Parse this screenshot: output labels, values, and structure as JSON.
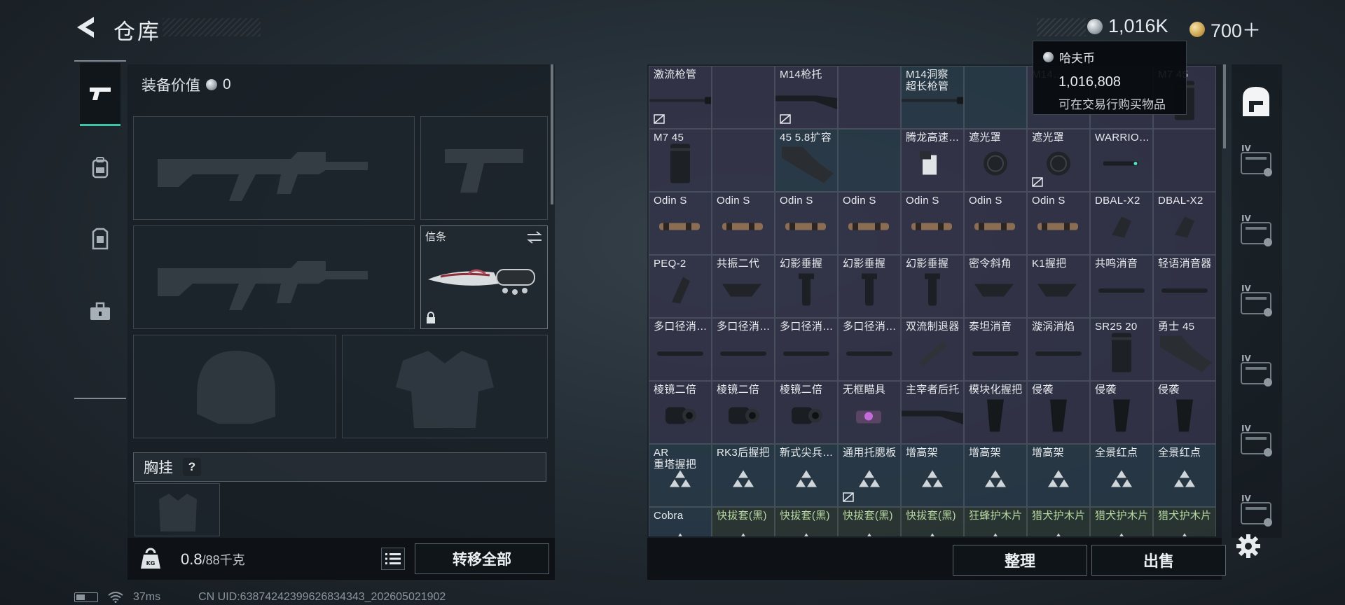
{
  "header": {
    "title": "仓库",
    "currency": [
      {
        "icon": "silver-coin-icon",
        "value": "1,016K"
      },
      {
        "icon": "gold-coin-icon",
        "value": "700＋"
      }
    ]
  },
  "tooltip": {
    "name": "哈夫币",
    "value": "1,016,808",
    "desc": "可在交易行购买物品"
  },
  "equipment": {
    "value_label": "装备价值",
    "value": "0",
    "melee_slot_label": "信条",
    "chest_label": "胸挂",
    "chest_help": "?",
    "weight_current": "0.8",
    "weight_max": "/88千克",
    "transfer_all": "转移全部"
  },
  "left_nav": [
    "weapon-tab-icon",
    "backpack-tab-icon",
    "armor-tab-icon",
    "toolbox-tab-icon"
  ],
  "inventory": {
    "rows": [
      [
        {
          "name": "激流枪管",
          "c": "purple",
          "icon": "barrel",
          "mark": true
        },
        {
          "name": "",
          "c": "purple"
        },
        {
          "name": "M14枪托",
          "c": "purple",
          "icon": "stock",
          "mark": true
        },
        {
          "name": "",
          "c": "purple"
        },
        {
          "name": "M14洞察\n超长枪管",
          "c": "blue",
          "icon": "barrel"
        },
        {
          "name": "",
          "c": "blue"
        },
        {
          "name": "M14…",
          "c": "purple"
        },
        {
          "name": "",
          "c": "purple"
        },
        {
          "name": "M7 45",
          "c": "purple",
          "icon": "mag"
        }
      ],
      [
        {
          "name": "M7 45",
          "c": "purple",
          "icon": "mag"
        },
        {
          "name": "",
          "c": "purple"
        },
        {
          "name": "45 5.8扩容",
          "c": "blue",
          "icon": "curvemag"
        },
        {
          "name": "",
          "c": "blue"
        },
        {
          "name": "腾龙高速…",
          "c": "purple",
          "icon": "clip"
        },
        {
          "name": "遮光罩",
          "c": "purple",
          "icon": "hood"
        },
        {
          "name": "遮光罩",
          "c": "purple",
          "icon": "hood",
          "mark": true
        },
        {
          "name": "WARRIO…",
          "c": "purple",
          "icon": "laser"
        },
        {
          "name": "",
          "c": "purple"
        }
      ],
      [
        {
          "name": "Odin S",
          "c": "purple",
          "icon": "flashlight"
        },
        {
          "name": "Odin S",
          "c": "purple",
          "icon": "flashlight"
        },
        {
          "name": "Odin S",
          "c": "purple",
          "icon": "flashlight"
        },
        {
          "name": "Odin S",
          "c": "purple",
          "icon": "flashlight"
        },
        {
          "name": "Odin S",
          "c": "purple",
          "icon": "flashlight"
        },
        {
          "name": "Odin S",
          "c": "purple",
          "icon": "flashlight"
        },
        {
          "name": "Odin S",
          "c": "purple",
          "icon": "flashlight"
        },
        {
          "name": "DBAL-X2",
          "c": "purple",
          "icon": "dbal"
        },
        {
          "name": "DBAL-X2",
          "c": "purple",
          "icon": "dbal"
        }
      ],
      [
        {
          "name": "PEQ-2",
          "c": "purple",
          "icon": "peq"
        },
        {
          "name": "共振二代",
          "c": "purple",
          "icon": "angled"
        },
        {
          "name": "幻影垂握",
          "c": "purple",
          "icon": "vgrip"
        },
        {
          "name": "幻影垂握",
          "c": "purple",
          "icon": "vgrip"
        },
        {
          "name": "幻影垂握",
          "c": "purple",
          "icon": "vgrip"
        },
        {
          "name": "密令斜角",
          "c": "purple",
          "icon": "angled"
        },
        {
          "name": "K1握把",
          "c": "purple",
          "icon": "angled"
        },
        {
          "name": "共鸣消音",
          "c": "purple",
          "icon": "suppressor"
        },
        {
          "name": "轻语消音器",
          "c": "purple",
          "icon": "suppressor"
        }
      ],
      [
        {
          "name": "多口径消…",
          "c": "purple",
          "icon": "suppressor"
        },
        {
          "name": "多口径消…",
          "c": "purple",
          "icon": "suppressor"
        },
        {
          "name": "多口径消…",
          "c": "purple",
          "icon": "suppressor"
        },
        {
          "name": "多口径消…",
          "c": "purple",
          "icon": "suppressor"
        },
        {
          "name": "双流制退器",
          "c": "purple",
          "icon": "brake"
        },
        {
          "name": "泰坦消音",
          "c": "purple",
          "icon": "suppressor"
        },
        {
          "name": "漩涡消焰",
          "c": "purple",
          "icon": "suppressor"
        },
        {
          "name": "SR25 20",
          "c": "purple",
          "icon": "mag"
        },
        {
          "name": "勇士 45",
          "c": "purple",
          "icon": "curvemag"
        }
      ],
      [
        {
          "name": "棱镜二倍",
          "c": "purple",
          "icon": "scope"
        },
        {
          "name": "棱镜二倍",
          "c": "purple",
          "icon": "scope"
        },
        {
          "name": "棱镜二倍",
          "c": "purple",
          "icon": "scope"
        },
        {
          "name": "无框瞄具",
          "c": "purple",
          "icon": "holo"
        },
        {
          "name": "主宰者后托",
          "c": "purple",
          "icon": "stock"
        },
        {
          "name": "模块化握把",
          "c": "purple",
          "icon": "pgrip"
        },
        {
          "name": "侵袭",
          "c": "purple",
          "icon": "pgrip"
        },
        {
          "name": "侵袭",
          "c": "purple",
          "icon": "pgrip"
        },
        {
          "name": "侵袭",
          "c": "purple",
          "icon": "pgrip"
        }
      ],
      [
        {
          "name": "AR\n重塔握把",
          "c": "blue",
          "icon": "pyramid"
        },
        {
          "name": "RK3后握把",
          "c": "blue",
          "icon": "pyramid"
        },
        {
          "name": "新式尖兵…",
          "c": "blue",
          "icon": "pyramid"
        },
        {
          "name": "通用托腮板",
          "c": "blue",
          "icon": "pyramid",
          "mark": true
        },
        {
          "name": "增高架",
          "c": "blue",
          "icon": "pyramid"
        },
        {
          "name": "增高架",
          "c": "blue",
          "icon": "pyramid"
        },
        {
          "name": "增高架",
          "c": "blue",
          "icon": "pyramid"
        },
        {
          "name": "全景红点",
          "c": "blue",
          "icon": "pyramid"
        },
        {
          "name": "全景红点",
          "c": "blue",
          "icon": "pyramid"
        }
      ],
      [
        {
          "name": "Cobra",
          "c": "blue",
          "icon": "pyramid"
        },
        {
          "name": "快拔套(黑)",
          "c": "green",
          "icon": "pyramid"
        },
        {
          "name": "快拔套(黑)",
          "c": "green",
          "icon": "pyramid"
        },
        {
          "name": "快拔套(黑)",
          "c": "green",
          "icon": "pyramid"
        },
        {
          "name": "快拔套(黑)",
          "c": "green",
          "icon": "pyramid"
        },
        {
          "name": "狂蜂护木片",
          "c": "green",
          "icon": "pyramid"
        },
        {
          "name": "猎犬护木片",
          "c": "green",
          "icon": "pyramid"
        },
        {
          "name": "猎犬护木片",
          "c": "green",
          "icon": "pyramid"
        },
        {
          "name": "猎犬护木片",
          "c": "green",
          "icon": "pyramid"
        }
      ]
    ],
    "sort_label": "整理",
    "sell_label": "出售"
  },
  "right_col": [
    "safe-box-icon",
    "case-iv-icon",
    "case-iv-icon",
    "case-iv-icon",
    "case-iv-icon",
    "case-iv-icon",
    "case-iv-icon"
  ],
  "status": {
    "ping": "37ms",
    "uid": "CN UID:63874242399626834343_202605021902"
  }
}
